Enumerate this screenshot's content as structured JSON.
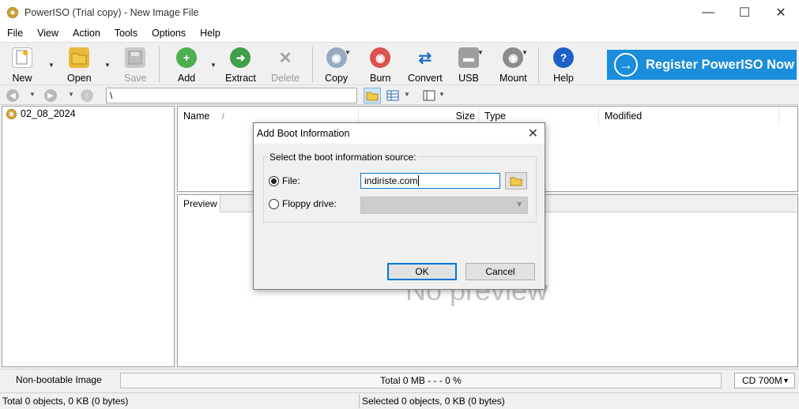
{
  "window": {
    "title": "PowerISO (Trial copy) - New Image File",
    "minimize": "—",
    "maximize": "☐",
    "close": "✕"
  },
  "menu": [
    "File",
    "View",
    "Action",
    "Tools",
    "Options",
    "Help"
  ],
  "toolbar": {
    "new": "New",
    "open": "Open",
    "save": "Save",
    "add": "Add",
    "extract": "Extract",
    "delete": "Delete",
    "copy": "Copy",
    "burn": "Burn",
    "convert": "Convert",
    "usb": "USB",
    "mount": "Mount",
    "help": "Help",
    "register": "Register PowerISO Now"
  },
  "address": {
    "path": "\\"
  },
  "tree": {
    "root": "02_08_2024"
  },
  "list": {
    "columns": [
      "Name",
      "Size",
      "Type",
      "Modified"
    ],
    "sort_indicator": "/"
  },
  "preview": {
    "tab": "Preview",
    "placeholder": "No preview"
  },
  "status": {
    "boot": "Non-bootable Image",
    "total": "Total  0 MB   - - -  0 %",
    "progress_percent": 0,
    "capacity": "CD 700M",
    "objects_total": "Total 0 objects, 0 KB (0 bytes)",
    "objects_selected": "Selected 0 objects, 0 KB (0 bytes)"
  },
  "dialog": {
    "title": "Add Boot Information",
    "group_label": "Select the boot information source:",
    "file_label": "File:",
    "file_value": "indiriste.com",
    "floppy_label": "Floppy drive:",
    "ok": "OK",
    "cancel": "Cancel",
    "selected_source": "file"
  },
  "colors": {
    "accent": "#1a8ddb",
    "progress": "#06b025",
    "focus": "#0078d7"
  }
}
